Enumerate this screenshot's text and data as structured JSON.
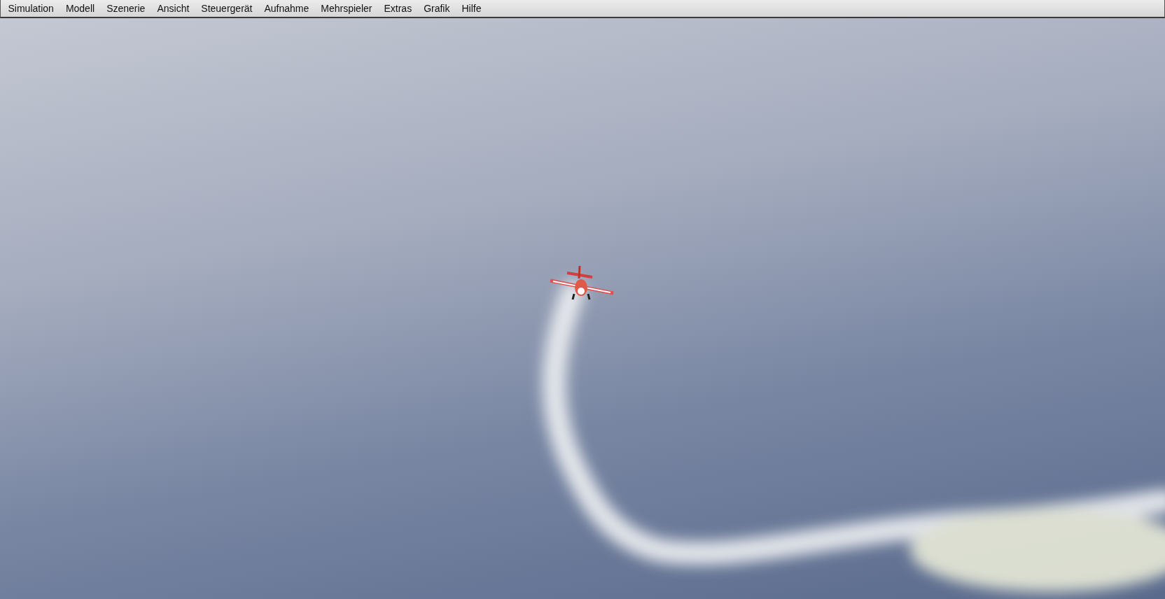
{
  "menu_bar": {
    "items": [
      {
        "label": "Simulation"
      },
      {
        "label": "Modell"
      },
      {
        "label": "Szenerie"
      },
      {
        "label": "Ansicht"
      },
      {
        "label": "Steuergerät"
      },
      {
        "label": "Aufnahme"
      },
      {
        "label": "Mehrspieler"
      },
      {
        "label": "Extras"
      },
      {
        "label": "Grafik"
      },
      {
        "label": "Hilfe"
      }
    ]
  }
}
